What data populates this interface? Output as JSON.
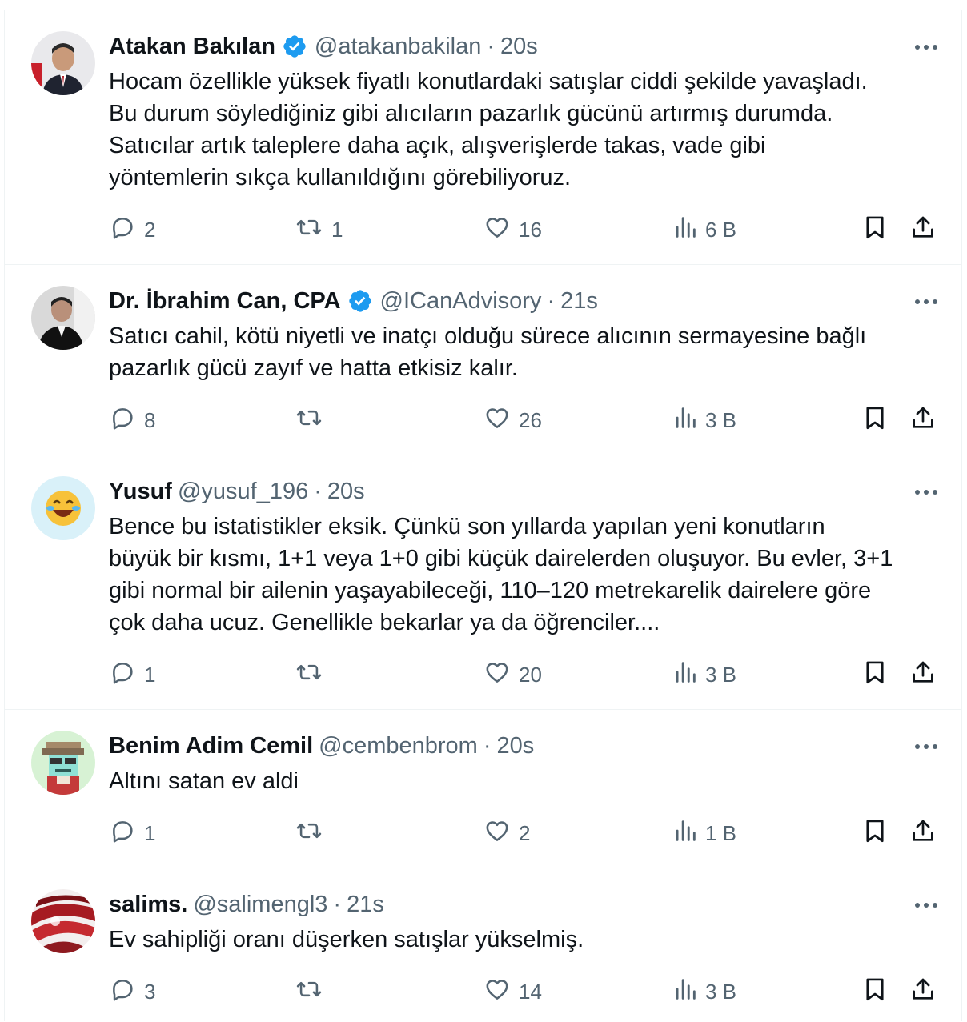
{
  "tweets": [
    {
      "name": "Atakan Bakılan",
      "verified": true,
      "handle": "@atakanbakilan",
      "time": "20s",
      "text": "Hocam özellikle yüksek fiyatlı konutlardaki satışlar ciddi şekilde yavaşladı.\nBu durum söylediğiniz gibi alıcıların pazarlık gücünü artırmış durumda.\nSatıcılar artık taleplere daha açık, alışverişlerde takas, vade gibi\nyöntemlerin sıkça kullanıldığını görebiliyoruz.",
      "replies": "2",
      "reposts": "1",
      "likes": "16",
      "views": "6 B"
    },
    {
      "name": "Dr. İbrahim Can, CPA",
      "verified": true,
      "handle": "@ICanAdvisory",
      "time": "21s",
      "text": "Satıcı cahil, kötü niyetli ve inatçı olduğu sürece alıcının sermayesine bağlı\npazarlık gücü zayıf ve hatta etkisiz kalır.",
      "replies": "8",
      "reposts": "",
      "likes": "26",
      "views": "3 B"
    },
    {
      "name": "Yusuf",
      "verified": false,
      "handle": "@yusuf_196",
      "time": "20s",
      "text": "Bence bu istatistikler eksik. Çünkü son yıllarda yapılan yeni konutların\nbüyük bir kısmı, 1+1 veya 1+0 gibi küçük dairelerden oluşuyor. Bu evler, 3+1\ngibi normal bir ailenin yaşayabileceği, 110–120 metrekarelik dairelere göre\nçok daha ucuz. Genellikle bekarlar ya da öğrenciler....",
      "replies": "1",
      "reposts": "",
      "likes": "20",
      "views": "3 B"
    },
    {
      "name": "Benim Adim Cemil",
      "verified": false,
      "handle": "@cembenbrom",
      "time": "20s",
      "text": "Altını satan ev aldi",
      "replies": "1",
      "reposts": "",
      "likes": "2",
      "views": "1 B"
    },
    {
      "name": "salims.",
      "verified": false,
      "handle": "@salimengl3",
      "time": "21s",
      "text": "Ev sahipliği oranı düşerken satışlar yükselmiş.",
      "replies": "3",
      "reposts": "",
      "likes": "14",
      "views": "3 B"
    }
  ],
  "ui": {
    "separator": "·",
    "icons": {
      "verified": "verified-badge-icon",
      "more": "more-dots-icon",
      "reply": "reply-bubble-icon",
      "repost": "repost-arrows-icon",
      "like": "heart-icon",
      "views": "views-bars-icon",
      "bookmark": "bookmark-icon",
      "share": "share-upload-icon"
    },
    "colors": {
      "verified": "#1d9bf0",
      "text": "#0f1419",
      "muted": "#536471",
      "border": "#eff3f4"
    }
  }
}
